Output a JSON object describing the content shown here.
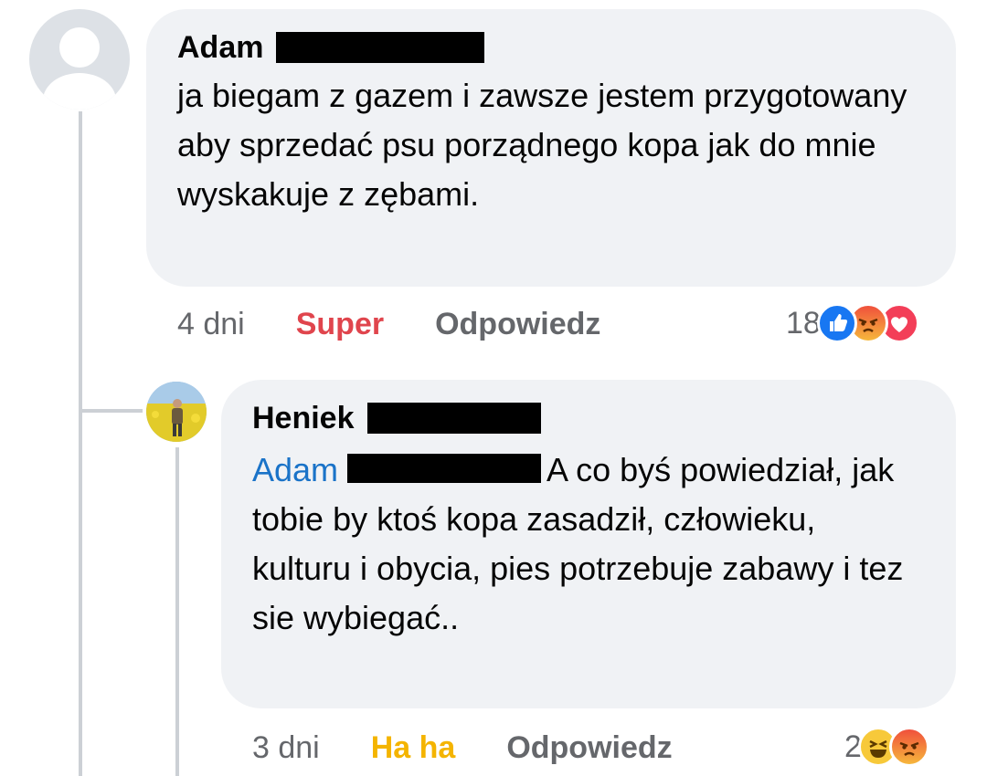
{
  "comments": [
    {
      "author": "Adam",
      "text": "ja biegam z gazem i zawsze jestem przygotowany aby sprzedać psu porządnego kopa jak do mnie wyskakuje z zębami.",
      "time": "4 dni",
      "my_reaction": "Super",
      "reply_label": "Odpowiedz",
      "reaction_count": "18",
      "reaction_icons": [
        "like-icon",
        "angry-icon",
        "love-icon"
      ]
    },
    {
      "author": "Heniek",
      "mention": "Adam",
      "text": "A co byś powiedział, jak tobie by ktoś kopa zasadził, człowieku, kulturu i obycia, pies potrzebuje zabawy i tez sie wybiegać..",
      "time": "3 dni",
      "my_reaction": "Ha ha",
      "reply_label": "Odpowiedz",
      "reaction_count": "2",
      "reaction_icons": [
        "haha-icon",
        "angry-icon"
      ]
    }
  ],
  "colors": {
    "bubble": "#f0f2f5",
    "meta_text": "#65676b",
    "mention": "#1a73c8",
    "super": "#e0454d",
    "haha": "#f4b400",
    "like": "#1877f2",
    "love": "#f33e58"
  }
}
